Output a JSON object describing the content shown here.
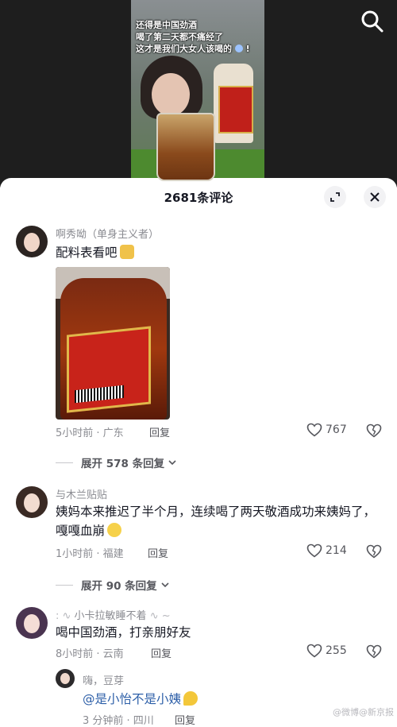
{
  "video": {
    "caption_lines": [
      "还得是中国劲酒",
      "喝了第二天都不痛经了",
      "这才是我们大女人该喝的"
    ]
  },
  "comments_sheet": {
    "title": "2681条评论",
    "comments": [
      {
        "username": "啊秀呦（单身主义者）",
        "text": "配料表看吧",
        "meta": "5小时前 · 广东",
        "reply_label": "回复",
        "likes": "767",
        "expand_label": "展开 578 条回复"
      },
      {
        "username": "与木兰贴贴",
        "text": "姨妈本来推迟了半个月，连续喝了两天敬酒成功来姨妈了，嘎嘎血崩",
        "meta": "1小时前 · 福建",
        "reply_label": "回复",
        "likes": "214",
        "expand_label": "展开 90 条回复"
      },
      {
        "username": "小卡拉敏睡不着",
        "text": "喝中国劲酒，打亲朋好友",
        "meta": "8小时前 · 云南",
        "reply_label": "回复",
        "likes": "255"
      }
    ],
    "nested_reply": {
      "username": "嗨，豆芽",
      "text": "@是小怡不是小姨",
      "meta": "3 分钟前 · 四川",
      "reply_label": "回复"
    }
  },
  "watermark": "@微博@新京报"
}
